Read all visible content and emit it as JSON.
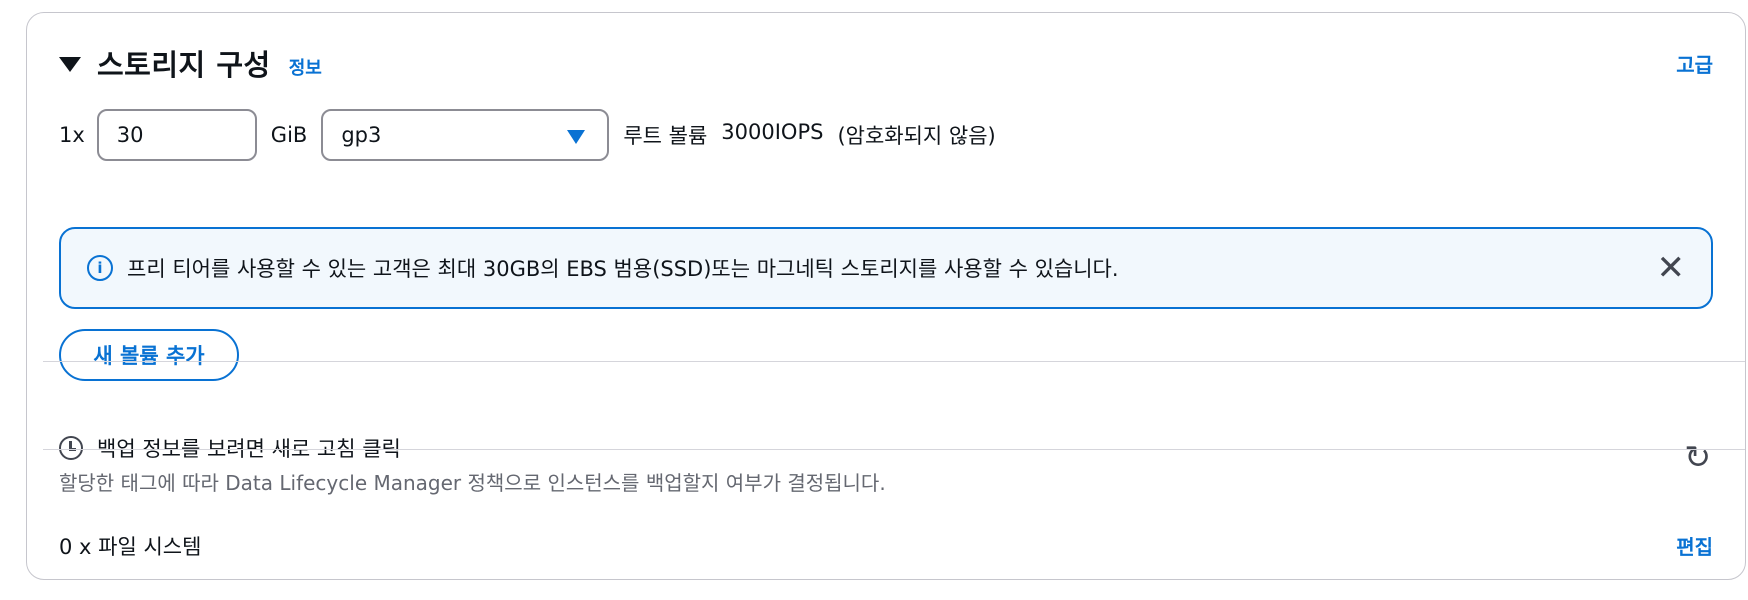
{
  "header": {
    "title": "스토리지 구성",
    "info_link": "정보",
    "advanced_link": "고급"
  },
  "volume": {
    "count": "1x",
    "size_value": "30",
    "size_unit": "GiB",
    "type": "gp3",
    "root_label": "루트 볼륨",
    "iops": "3000IOPS",
    "encryption": "(암호화되지 않음)"
  },
  "alert": {
    "message": "프리 티어를 사용할 수 있는 고객은 최대 30GB의 EBS 범용(SSD)또는 마그네틱 스토리지를 사용할 수 있습니다."
  },
  "add_volume_label": "새 볼륨 추가",
  "backup": {
    "title": "백업 정보를 보려면 새로 고침 클릭",
    "description": "할당한 태그에 따라 Data Lifecycle Manager 정책으로 인스턴스를 백업할지 여부가 결정됩니다."
  },
  "file_systems": {
    "label": "0 x 파일 시스템",
    "edit_link": "편집"
  },
  "colors": {
    "accent": "#0972d3",
    "alert_bg": "#f2f8fd",
    "border": "#c6c6cd"
  }
}
